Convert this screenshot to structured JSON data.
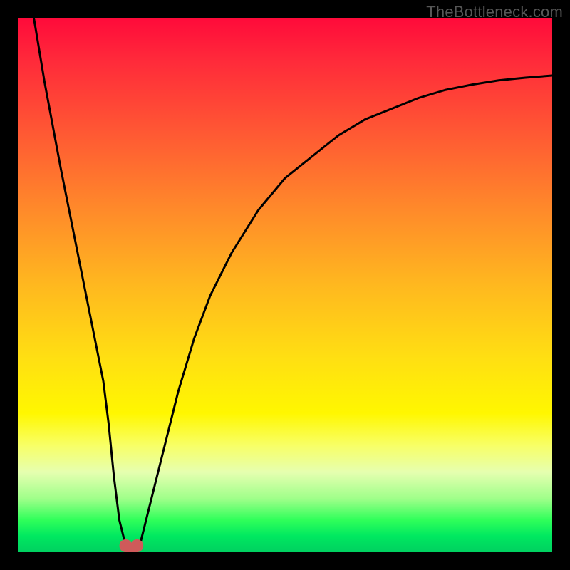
{
  "watermark": "TheBottleneck.com",
  "chart_data": {
    "type": "line",
    "title": "",
    "xlabel": "",
    "ylabel": "",
    "xlim": [
      0,
      100
    ],
    "ylim": [
      0,
      100
    ],
    "grid": false,
    "series": [
      {
        "name": "curve",
        "color": "#000000",
        "x": [
          3,
          5,
          8,
          10,
          12,
          14,
          16,
          17,
          18,
          19,
          20,
          21,
          22,
          23,
          24,
          26,
          28,
          30,
          33,
          36,
          40,
          45,
          50,
          55,
          60,
          65,
          70,
          75,
          80,
          85,
          90,
          95,
          100
        ],
        "y": [
          100,
          88,
          72,
          62,
          52,
          42,
          32,
          24,
          14,
          6,
          2,
          1,
          1,
          2,
          6,
          14,
          22,
          30,
          40,
          48,
          56,
          64,
          70,
          74,
          78,
          81,
          83,
          85,
          86.5,
          87.5,
          88.3,
          88.8,
          89.2
        ]
      }
    ],
    "markers": [
      {
        "name": "dip-left",
        "x": 20.2,
        "y": 1.2,
        "color": "#cf5a5a"
      },
      {
        "name": "dip-right",
        "x": 22.3,
        "y": 1.2,
        "color": "#cf5a5a"
      }
    ],
    "optimum_x": 21
  }
}
